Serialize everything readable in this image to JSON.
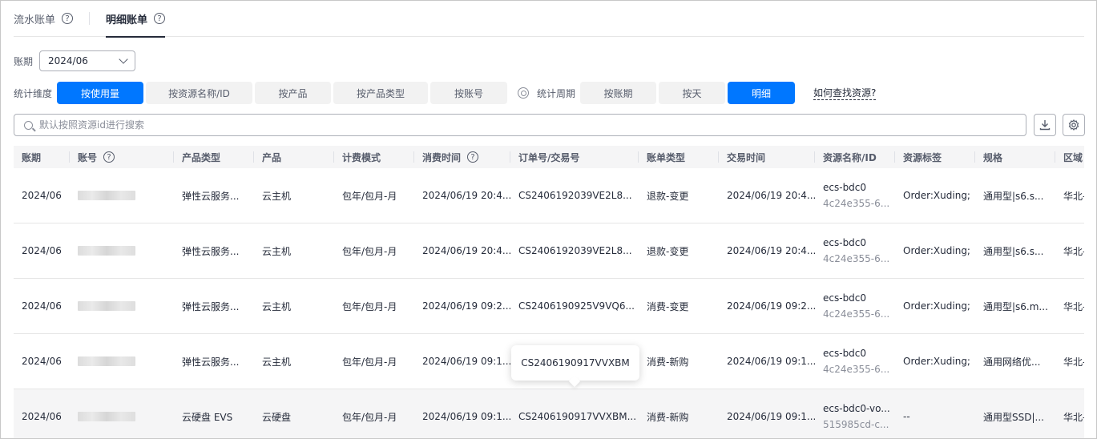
{
  "tabs": [
    {
      "label": "流水账单",
      "active": false
    },
    {
      "label": "明细账单",
      "active": true
    }
  ],
  "period": {
    "label": "账期",
    "value": "2024/06"
  },
  "dimension": {
    "label": "统计维度",
    "options": [
      "按使用量",
      "按资源名称/ID",
      "按产品",
      "按产品类型",
      "按账号"
    ],
    "active": "按使用量"
  },
  "cycle": {
    "label": "统计周期",
    "options": [
      "按账期",
      "按天",
      "明细"
    ],
    "active": "明细"
  },
  "find_resource_link": "如何查找资源?",
  "search": {
    "placeholder": "默认按照资源id进行搜索"
  },
  "icons": {
    "download": "download-icon",
    "settings": "gear-icon",
    "search": "search-icon"
  },
  "colors": {
    "accent": "#0077ff"
  },
  "table": {
    "headers": [
      "账期",
      "账号",
      "产品类型",
      "产品",
      "计费模式",
      "消费时间",
      "订单号/交易号",
      "账单类型",
      "交易时间",
      "资源名称/ID",
      "资源标签",
      "规格",
      "区域"
    ],
    "rows": [
      {
        "period": "2024/06",
        "product_type": "弹性云服务...",
        "product": "云主机",
        "billing": "包年/包月-月",
        "consume_time": "2024/06/19 20:4...",
        "order": "CS2406192039VE2L8...",
        "bill_type": "退款-变更",
        "trade_time": "2024/06/19 20:4...",
        "res_name": "ecs-bdc0",
        "res_id": "4c24e355-6...",
        "tag": "Order:Xuding;",
        "spec": "通用型|s6.s...",
        "region": "华北-"
      },
      {
        "period": "2024/06",
        "product_type": "弹性云服务...",
        "product": "云主机",
        "billing": "包年/包月-月",
        "consume_time": "2024/06/19 20:4...",
        "order": "CS2406192039VE2L8...",
        "bill_type": "退款-变更",
        "trade_time": "2024/06/19 20:4...",
        "res_name": "ecs-bdc0",
        "res_id": "4c24e355-6...",
        "tag": "Order:Xuding;",
        "spec": "通用型|s6.s...",
        "region": "华北-"
      },
      {
        "period": "2024/06",
        "product_type": "弹性云服务...",
        "product": "云主机",
        "billing": "包年/包月-月",
        "consume_time": "2024/06/19 09:2...",
        "order": "CS2406190925V9VQ6...",
        "bill_type": "消费-变更",
        "trade_time": "2024/06/19 09:2...",
        "res_name": "ecs-bdc0",
        "res_id": "4c24e355-6...",
        "tag": "Order:Xuding;",
        "spec": "通用型|s6.m...",
        "region": "华北-"
      },
      {
        "period": "2024/06",
        "product_type": "弹性云服务...",
        "product": "云主机",
        "billing": "包年/包月-月",
        "consume_time": "2024/06/19 09:1...",
        "order": "",
        "bill_type": "消费-新购",
        "trade_time": "2024/06/19 09:1...",
        "res_name": "ecs-bdc0",
        "res_id": "4c24e355-6...",
        "tag": "Order:Xuding;",
        "spec": "通用网络优...",
        "region": "华北-"
      },
      {
        "period": "2024/06",
        "product_type": "云硬盘 EVS",
        "product": "云硬盘",
        "billing": "包年/包月-月",
        "consume_time": "2024/06/19 09:1...",
        "order": "CS2406190917VVXBM...",
        "bill_type": "消费-新购",
        "trade_time": "2024/06/19 09:1...",
        "res_name": "ecs-bdc0-vo...",
        "res_id": "515985cd-c...",
        "tag": "--",
        "spec": "通用型SSD|...",
        "region": "华北-"
      }
    ]
  },
  "tooltip": {
    "text": "CS2406190917VVXBM"
  }
}
